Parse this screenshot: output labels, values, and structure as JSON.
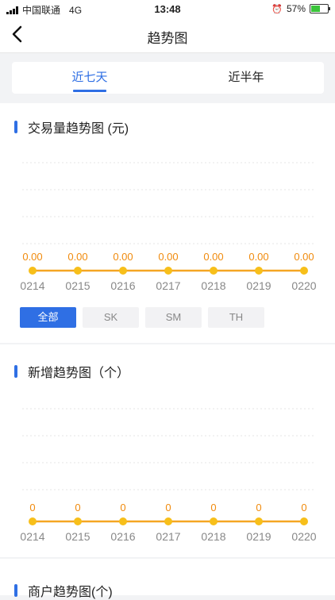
{
  "status_bar": {
    "carrier": "中国联通",
    "network": "4G",
    "time": "13:48",
    "battery": "57%",
    "battery_level": 0.57
  },
  "nav": {
    "title": "趋势图",
    "back_icon": "chevron-left-icon"
  },
  "tabs": [
    {
      "label": "近七天",
      "active": true
    },
    {
      "label": "近半年",
      "active": false
    }
  ],
  "accent": "#2f6fe4",
  "chart_data": [
    {
      "type": "line",
      "title": "交易量趋势图 (元)",
      "categories": [
        "0214",
        "0215",
        "0216",
        "0217",
        "0218",
        "0219",
        "0220"
      ],
      "values": [
        0,
        0,
        0,
        0,
        0,
        0,
        0
      ],
      "data_labels": [
        "0.00",
        "0.00",
        "0.00",
        "0.00",
        "0.00",
        "0.00",
        "0.00"
      ],
      "grid": true,
      "line_color": "#f5a623",
      "point_color": "#f7bf1a"
    },
    {
      "type": "line",
      "title": "新增趋势图（个）",
      "categories": [
        "0214",
        "0215",
        "0216",
        "0217",
        "0218",
        "0219",
        "0220"
      ],
      "values": [
        0,
        0,
        0,
        0,
        0,
        0,
        0
      ],
      "data_labels": [
        "0",
        "0",
        "0",
        "0",
        "0",
        "0",
        "0"
      ],
      "grid": true,
      "line_color": "#f5a623",
      "point_color": "#f7bf1a"
    }
  ],
  "filters": [
    {
      "label": "全部",
      "active": true
    },
    {
      "label": "SK",
      "active": false
    },
    {
      "label": "SM",
      "active": false
    },
    {
      "label": "TH",
      "active": false
    }
  ],
  "section3": {
    "title": "商户趋势图(个)"
  }
}
